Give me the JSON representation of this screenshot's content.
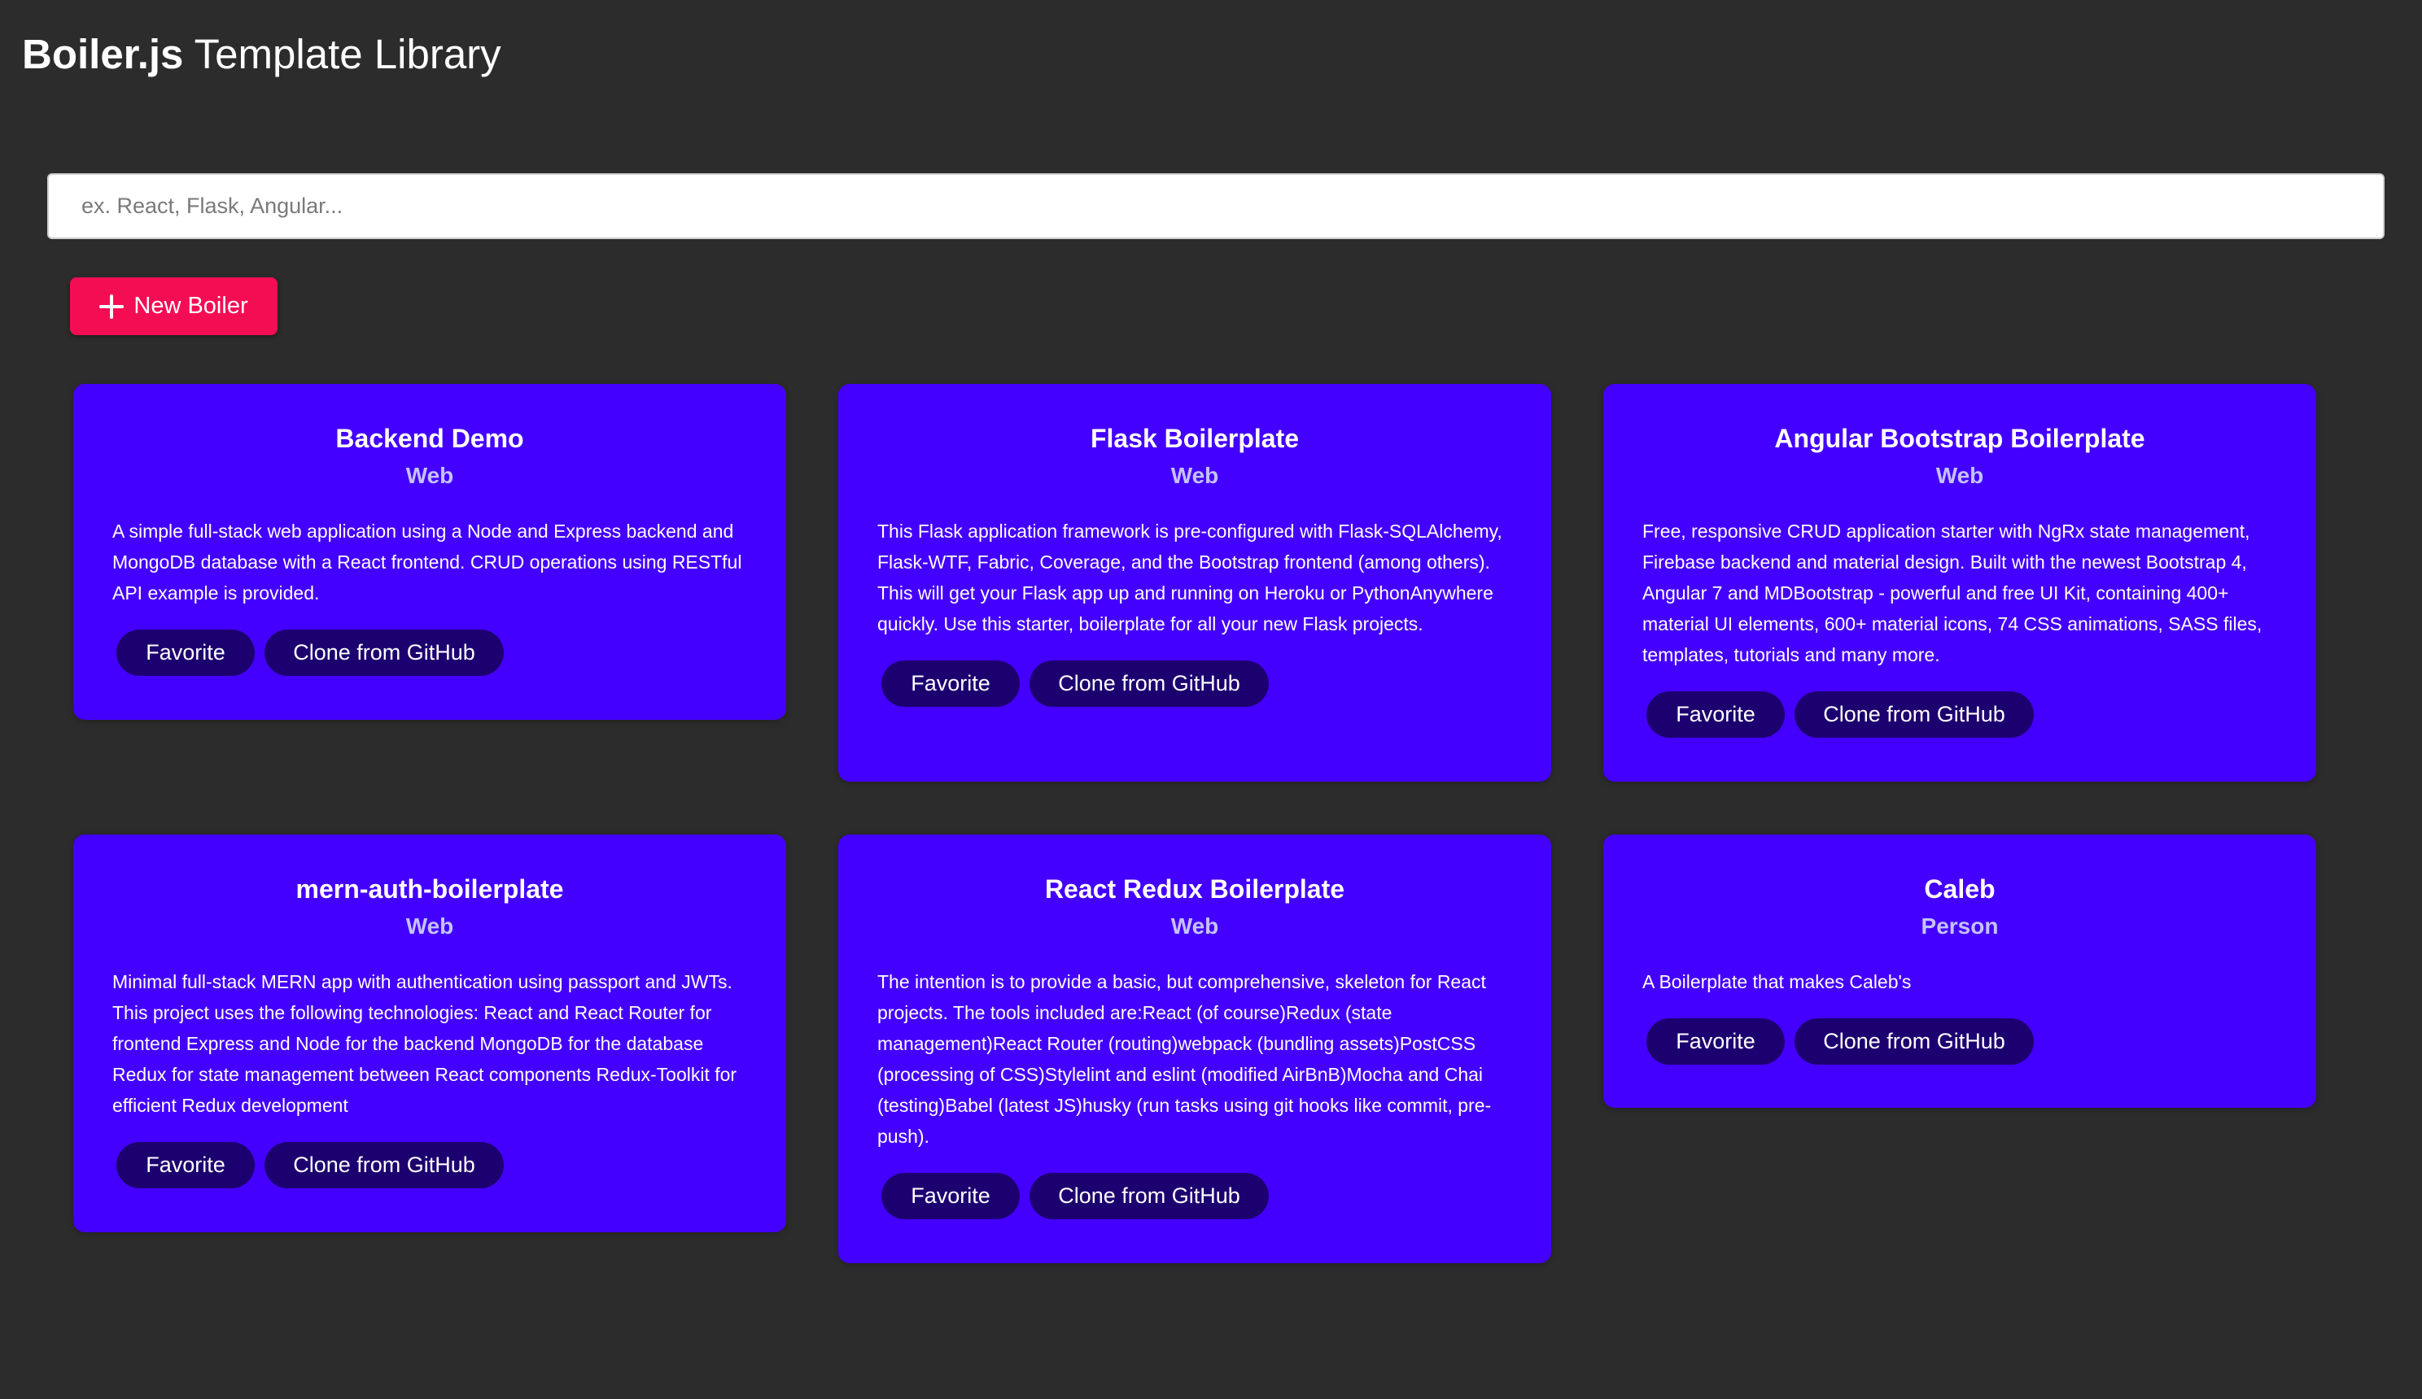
{
  "header": {
    "brand": "Boiler.js",
    "subtitle": "Template Library"
  },
  "search": {
    "placeholder": "ex. React, Flask, Angular...",
    "value": ""
  },
  "toolbar": {
    "new_boiler_label": "New Boiler",
    "new_boiler_icon": "plus-icon"
  },
  "colors": {
    "background": "#2c2c2c",
    "card": "#4400ff",
    "card_button": "#1c0070",
    "accent": "#f50d54",
    "category_text": "#c4c2ff"
  },
  "cards": [
    {
      "title": "Backend Demo",
      "category": "Web",
      "description": "A simple full-stack web application using a Node and Express backend and MongoDB database with a React frontend. CRUD operations using RESTful API example is provided.",
      "favorite_label": "Favorite",
      "clone_label": "Clone from GitHub"
    },
    {
      "title": "Flask Boilerplate",
      "category": "Web",
      "description": "This Flask application framework is pre-configured with Flask-SQLAlchemy, Flask-WTF, Fabric, Coverage, and the Bootstrap frontend (among others). This will get your Flask app up and running on Heroku or PythonAnywhere quickly. Use this starter, boilerplate for all your new Flask projects.",
      "favorite_label": "Favorite",
      "clone_label": "Clone from GitHub"
    },
    {
      "title": "Angular Bootstrap Boilerplate",
      "category": "Web",
      "description": "Free, responsive CRUD application starter with NgRx state management, Firebase backend and material design. Built with the newest Bootstrap 4, Angular 7 and MDBootstrap - powerful and free UI Kit, containing 400+ material UI elements, 600+ material icons, 74 CSS animations, SASS files, templates, tutorials and many more.",
      "favorite_label": "Favorite",
      "clone_label": "Clone from GitHub"
    },
    {
      "title": "mern-auth-boilerplate",
      "category": "Web",
      "description": "Minimal full-stack MERN app with authentication using passport and JWTs. This project uses the following technologies: React and React Router for frontend Express and Node for the backend MongoDB for the database Redux for state management between React components Redux-Toolkit for efficient Redux development",
      "favorite_label": "Favorite",
      "clone_label": "Clone from GitHub"
    },
    {
      "title": "React Redux Boilerplate",
      "category": "Web",
      "description": "The intention is to provide a basic, but comprehensive, skeleton for React projects. The tools included are:React (of course)Redux (state management)React Router (routing)webpack (bundling assets)PostCSS (processing of CSS)Stylelint and eslint (modified AirBnB)Mocha and Chai (testing)Babel (latest JS)husky (run tasks using git hooks like commit, pre-push).",
      "favorite_label": "Favorite",
      "clone_label": "Clone from GitHub"
    },
    {
      "title": "Caleb",
      "category": "Person",
      "description": "A Boilerplate that makes Caleb's",
      "favorite_label": "Favorite",
      "clone_label": "Clone from GitHub"
    }
  ]
}
